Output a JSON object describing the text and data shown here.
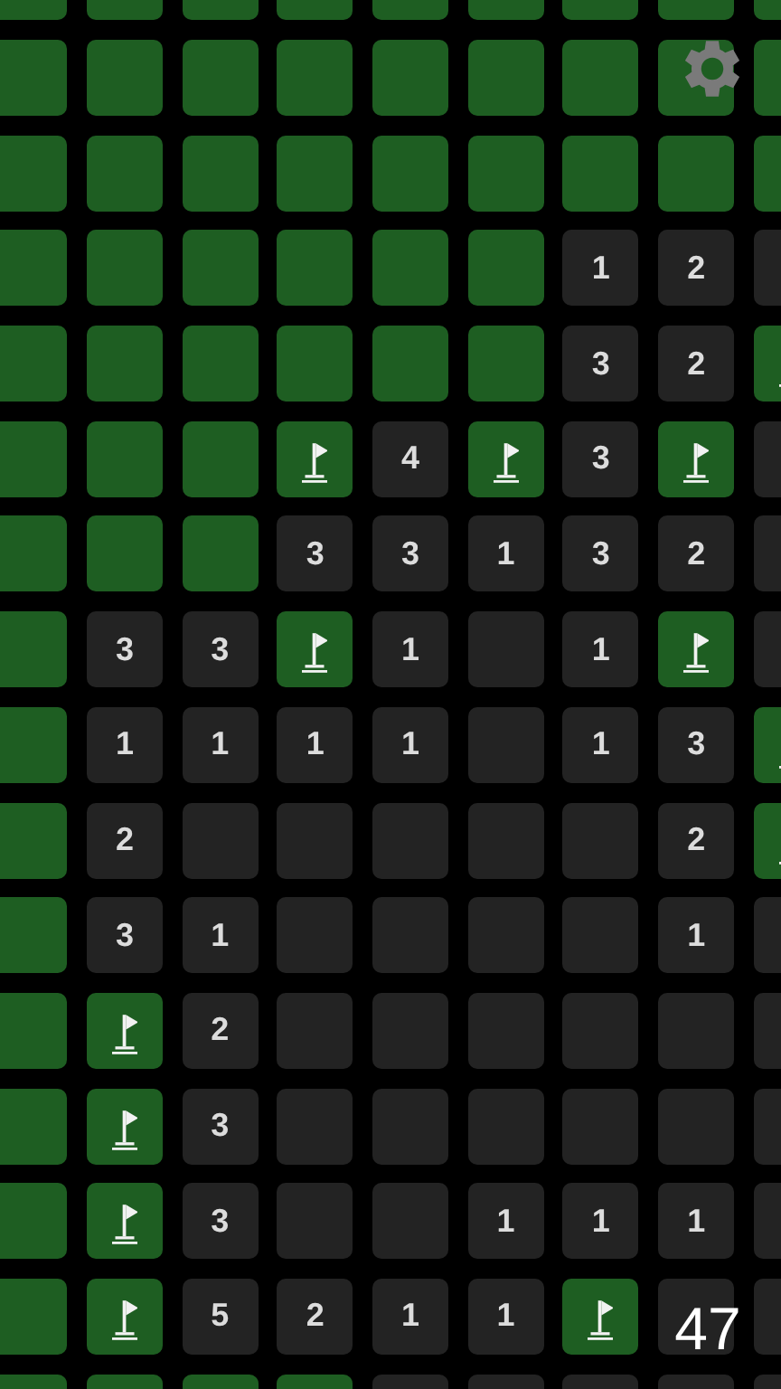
{
  "board": {
    "rows": [
      [
        {
          "kind": "covered"
        },
        {
          "kind": "covered"
        },
        {
          "kind": "covered"
        },
        {
          "kind": "covered"
        },
        {
          "kind": "covered"
        },
        {
          "kind": "covered"
        },
        {
          "kind": "covered"
        },
        {
          "kind": "covered"
        },
        {
          "kind": "covered"
        }
      ],
      [
        {
          "kind": "covered"
        },
        {
          "kind": "covered"
        },
        {
          "kind": "covered"
        },
        {
          "kind": "covered"
        },
        {
          "kind": "covered"
        },
        {
          "kind": "covered"
        },
        {
          "kind": "covered"
        },
        {
          "kind": "covered"
        },
        {
          "kind": "covered"
        }
      ],
      [
        {
          "kind": "covered"
        },
        {
          "kind": "covered"
        },
        {
          "kind": "covered"
        },
        {
          "kind": "covered"
        },
        {
          "kind": "covered"
        },
        {
          "kind": "covered"
        },
        {
          "kind": "covered"
        },
        {
          "kind": "covered"
        },
        {
          "kind": "covered"
        }
      ],
      [
        {
          "kind": "covered"
        },
        {
          "kind": "covered"
        },
        {
          "kind": "covered"
        },
        {
          "kind": "covered"
        },
        {
          "kind": "covered"
        },
        {
          "kind": "covered"
        },
        {
          "kind": "open",
          "number": "1"
        },
        {
          "kind": "open",
          "number": "2"
        },
        {
          "kind": "open"
        }
      ],
      [
        {
          "kind": "covered"
        },
        {
          "kind": "covered"
        },
        {
          "kind": "covered"
        },
        {
          "kind": "covered"
        },
        {
          "kind": "covered"
        },
        {
          "kind": "covered"
        },
        {
          "kind": "open",
          "number": "3"
        },
        {
          "kind": "open",
          "number": "2"
        },
        {
          "kind": "flag"
        }
      ],
      [
        {
          "kind": "covered"
        },
        {
          "kind": "covered"
        },
        {
          "kind": "covered"
        },
        {
          "kind": "flag"
        },
        {
          "kind": "open",
          "number": "4"
        },
        {
          "kind": "flag"
        },
        {
          "kind": "open",
          "number": "3"
        },
        {
          "kind": "flag"
        },
        {
          "kind": "open"
        }
      ],
      [
        {
          "kind": "covered"
        },
        {
          "kind": "covered"
        },
        {
          "kind": "covered"
        },
        {
          "kind": "open",
          "number": "3"
        },
        {
          "kind": "open",
          "number": "3"
        },
        {
          "kind": "open",
          "number": "1"
        },
        {
          "kind": "open",
          "number": "3"
        },
        {
          "kind": "open",
          "number": "2"
        },
        {
          "kind": "open"
        }
      ],
      [
        {
          "kind": "covered"
        },
        {
          "kind": "open",
          "number": "3"
        },
        {
          "kind": "open",
          "number": "3"
        },
        {
          "kind": "flag"
        },
        {
          "kind": "open",
          "number": "1"
        },
        {
          "kind": "open"
        },
        {
          "kind": "open",
          "number": "1"
        },
        {
          "kind": "flag"
        },
        {
          "kind": "open"
        }
      ],
      [
        {
          "kind": "covered"
        },
        {
          "kind": "open",
          "number": "1"
        },
        {
          "kind": "open",
          "number": "1"
        },
        {
          "kind": "open",
          "number": "1"
        },
        {
          "kind": "open",
          "number": "1"
        },
        {
          "kind": "open"
        },
        {
          "kind": "open",
          "number": "1"
        },
        {
          "kind": "open",
          "number": "3"
        },
        {
          "kind": "flag"
        }
      ],
      [
        {
          "kind": "covered"
        },
        {
          "kind": "open",
          "number": "2"
        },
        {
          "kind": "open"
        },
        {
          "kind": "open"
        },
        {
          "kind": "open"
        },
        {
          "kind": "open"
        },
        {
          "kind": "open"
        },
        {
          "kind": "open",
          "number": "2"
        },
        {
          "kind": "flag"
        }
      ],
      [
        {
          "kind": "covered"
        },
        {
          "kind": "open",
          "number": "3"
        },
        {
          "kind": "open",
          "number": "1"
        },
        {
          "kind": "open"
        },
        {
          "kind": "open"
        },
        {
          "kind": "open"
        },
        {
          "kind": "open"
        },
        {
          "kind": "open",
          "number": "1"
        },
        {
          "kind": "open"
        }
      ],
      [
        {
          "kind": "covered"
        },
        {
          "kind": "flag"
        },
        {
          "kind": "open",
          "number": "2"
        },
        {
          "kind": "open"
        },
        {
          "kind": "open"
        },
        {
          "kind": "open"
        },
        {
          "kind": "open"
        },
        {
          "kind": "open"
        },
        {
          "kind": "open"
        }
      ],
      [
        {
          "kind": "covered"
        },
        {
          "kind": "flag"
        },
        {
          "kind": "open",
          "number": "3"
        },
        {
          "kind": "open"
        },
        {
          "kind": "open"
        },
        {
          "kind": "open"
        },
        {
          "kind": "open"
        },
        {
          "kind": "open"
        },
        {
          "kind": "open"
        }
      ],
      [
        {
          "kind": "covered"
        },
        {
          "kind": "flag"
        },
        {
          "kind": "open",
          "number": "3"
        },
        {
          "kind": "open"
        },
        {
          "kind": "open"
        },
        {
          "kind": "open",
          "number": "1"
        },
        {
          "kind": "open",
          "number": "1"
        },
        {
          "kind": "open",
          "number": "1"
        },
        {
          "kind": "open"
        }
      ],
      [
        {
          "kind": "covered"
        },
        {
          "kind": "flag"
        },
        {
          "kind": "open",
          "number": "5"
        },
        {
          "kind": "open",
          "number": "2"
        },
        {
          "kind": "open",
          "number": "1"
        },
        {
          "kind": "open",
          "number": "1"
        },
        {
          "kind": "flag"
        },
        {
          "kind": "open"
        },
        {
          "kind": "open"
        }
      ],
      [
        {
          "kind": "covered"
        },
        {
          "kind": "covered"
        },
        {
          "kind": "covered"
        },
        {
          "kind": "covered"
        },
        {
          "kind": "open"
        },
        {
          "kind": "open"
        },
        {
          "kind": "open"
        },
        {
          "kind": "open"
        },
        {
          "kind": "open"
        }
      ]
    ]
  },
  "counter": "47"
}
